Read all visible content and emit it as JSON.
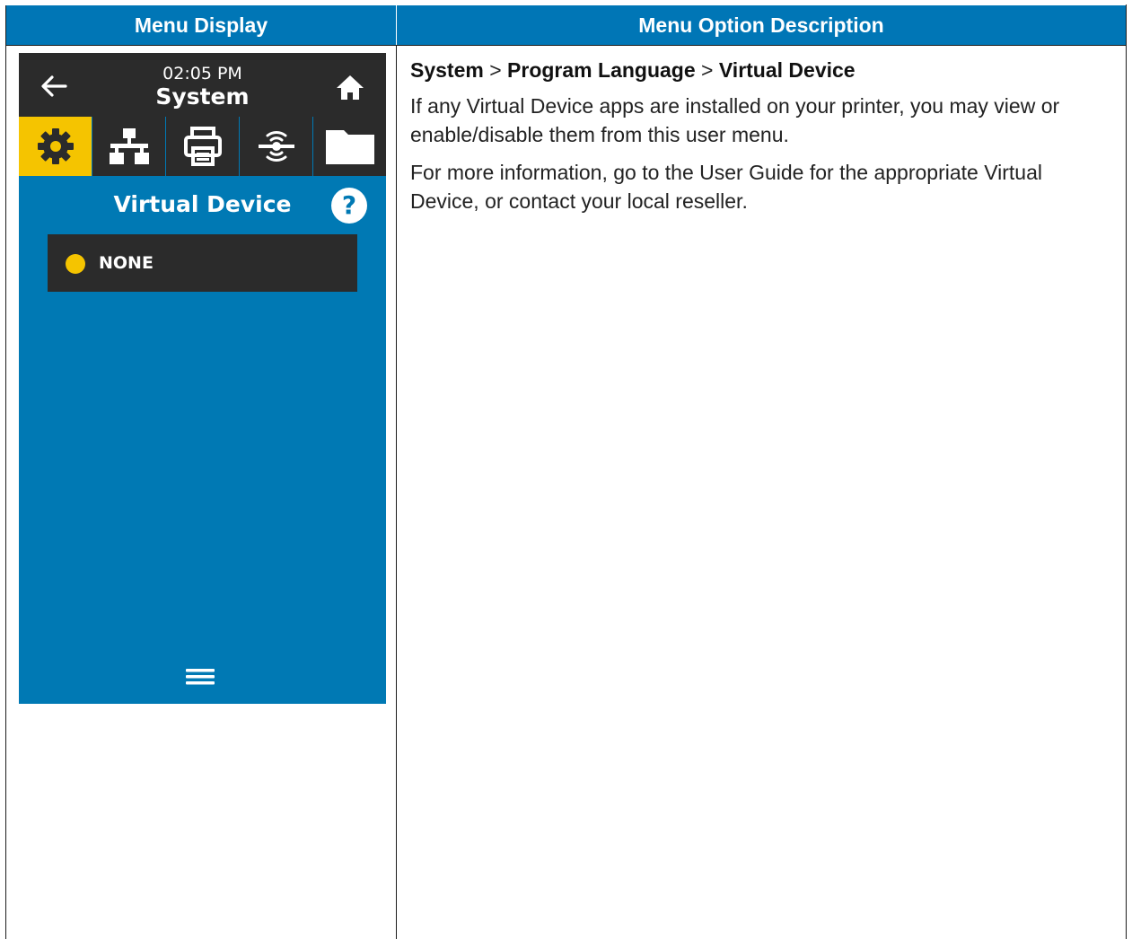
{
  "table": {
    "col1_header": "Menu Display",
    "col2_header": "Menu Option Description"
  },
  "screen": {
    "time": "02:05 PM",
    "title": "System",
    "page_title": "Virtual Device",
    "help_label": "?",
    "tabs": [
      {
        "icon": "gear-icon",
        "active": true
      },
      {
        "icon": "network-icon",
        "active": false
      },
      {
        "icon": "printer-icon",
        "active": false
      },
      {
        "icon": "rfid-icon",
        "active": false
      },
      {
        "icon": "folder-icon",
        "active": false
      }
    ],
    "option": {
      "label": "NONE",
      "selected": true
    },
    "colors": {
      "screen_bg": "#0079b4",
      "header_bg": "#2b2b2b",
      "accent": "#f5c400",
      "table_header_bg": "#0076b6"
    }
  },
  "description": {
    "path": {
      "part1": "System",
      "sep1": " > ",
      "part2": "Program Language",
      "sep2": " > ",
      "part3": "Virtual Device"
    },
    "paragraph1": "If any Virtual Device apps are installed on your printer, you may view or enable/disable them from this user menu.",
    "paragraph2": "For more information, go to the User Guide for the appropriate Virtual Device, or contact your local reseller."
  }
}
